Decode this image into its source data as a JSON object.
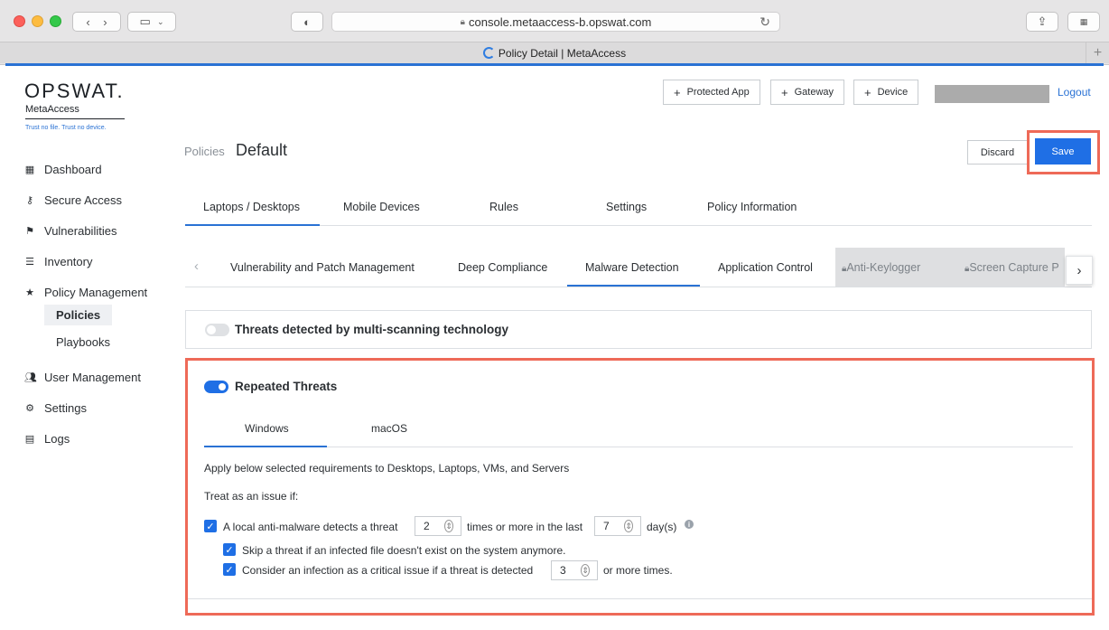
{
  "browser": {
    "url": "console.metaaccess-b.opswat.com",
    "tab_title": "Policy Detail | MetaAccess"
  },
  "brand": {
    "logo": "OPSWAT.",
    "product": "MetaAccess",
    "tagline": "Trust no file. Trust no device."
  },
  "sidebar": {
    "items": [
      {
        "label": "Dashboard",
        "icon": "grid-icon"
      },
      {
        "label": "Secure Access",
        "icon": "key-icon"
      },
      {
        "label": "Vulnerabilities",
        "icon": "flag-icon"
      },
      {
        "label": "Inventory",
        "icon": "list-icon"
      },
      {
        "label": "Policy Management",
        "icon": "star-icon"
      },
      {
        "label": "User Management",
        "icon": "users-icon"
      },
      {
        "label": "Settings",
        "icon": "gear-icon"
      },
      {
        "label": "Logs",
        "icon": "clipboard-icon"
      }
    ],
    "sub_items": [
      "Policies",
      "Playbooks"
    ]
  },
  "header": {
    "protected_app": "Protected App",
    "gateway": "Gateway",
    "device": "Device",
    "logout": "Logout"
  },
  "page": {
    "breadcrumb": "Policies",
    "title": "Default",
    "discard": "Discard",
    "save": "Save"
  },
  "tabs": [
    "Laptops / Desktops",
    "Mobile Devices",
    "Rules",
    "Settings",
    "Policy Information"
  ],
  "subtabs": [
    "Vulnerability and Patch Management",
    "Deep Compliance",
    "Malware Detection",
    "Application Control",
    "Anti-Keylogger",
    "Screen Capture P"
  ],
  "panel_multiscan": {
    "title": "Threats detected by multi-scanning technology",
    "enabled": false
  },
  "panel_repeated": {
    "title": "Repeated Threats",
    "enabled": true,
    "os_tabs": [
      "Windows",
      "macOS"
    ],
    "apply_text": "Apply below selected requirements to Desktops, Laptops, VMs, and Servers",
    "treat_text": "Treat as an issue if:",
    "rule1_prefix": "A local anti-malware detects a threat",
    "rule1_count": "2",
    "rule1_mid": "times or more in the last",
    "rule1_days": "7",
    "rule1_suffix": "day(s)",
    "rule2": "Skip a threat if an infected file doesn't exist on the system anymore.",
    "rule3_prefix": "Consider an infection as a critical issue if a threat is detected",
    "rule3_count": "3",
    "rule3_suffix": "or more times."
  }
}
